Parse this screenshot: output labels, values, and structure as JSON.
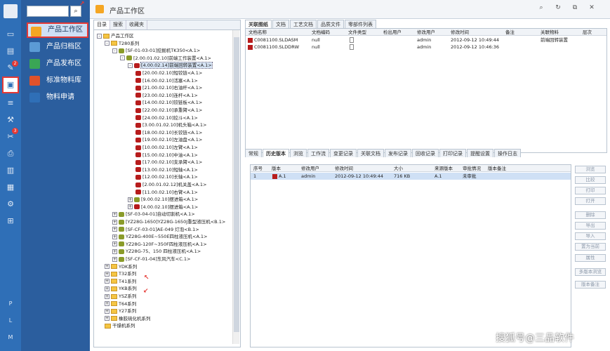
{
  "window": {
    "title": "产品工作区",
    "controls": [
      "⌕",
      "↻",
      "⧉",
      "✕"
    ]
  },
  "rail": {
    "badges": [
      "2",
      "3"
    ],
    "letters": [
      "P",
      "L",
      "M"
    ]
  },
  "nav": {
    "search_placeholder": "",
    "items": [
      {
        "label": "产品工作区",
        "icon": "product-workspace-icon",
        "color": "#f5a623",
        "active": true
      },
      {
        "label": "产品归档区",
        "icon": "archive-icon",
        "color": "#5b9bd5",
        "active": false
      },
      {
        "label": "产品发布区",
        "icon": "publish-icon",
        "color": "#3aa655",
        "active": false
      },
      {
        "label": "标准物料库",
        "icon": "material-library-icon",
        "color": "#e0522b",
        "active": false
      },
      {
        "label": "物料申请",
        "icon": "material-request-icon",
        "color": "#2f6fb7",
        "active": false
      }
    ]
  },
  "tree": {
    "tabs": [
      "目录",
      "搜索",
      "收藏夹"
    ],
    "nodes": [
      {
        "text": "产品工作区",
        "level": 0,
        "kind": "folder",
        "exp": "-"
      },
      {
        "text": "T280系列",
        "level": 1,
        "kind": "folder",
        "exp": "-"
      },
      {
        "text": "[SF-01-03-01]挖掘机TK350<A.1>",
        "level": 2,
        "kind": "asm",
        "exp": "-"
      },
      {
        "text": "[2.00.01.02.10]前端工作装置<A.1>",
        "level": 3,
        "kind": "asm",
        "exp": "-"
      },
      {
        "text": "[4.00.02.14]前端回转装置<A.1>",
        "level": 4,
        "kind": "part",
        "exp": "-",
        "selected": true
      },
      {
        "text": "[20.00.02.10]短铰链<A.1>",
        "level": 5,
        "kind": "part"
      },
      {
        "text": "[16.00.02.10]活塞<A.1>",
        "level": 5,
        "kind": "part"
      },
      {
        "text": "[21.00.02.10]右油杆<A.1>",
        "level": 5,
        "kind": "part"
      },
      {
        "text": "[23.00.02.10]连杆<A.1>",
        "level": 5,
        "kind": "part"
      },
      {
        "text": "[14.00.02.10]铰链板<A.1>",
        "level": 5,
        "kind": "part"
      },
      {
        "text": "[22.00.02.10]承重臂<A.1>",
        "level": 5,
        "kind": "part"
      },
      {
        "text": "[24.00.02.10]挖斗<A.1>",
        "level": 5,
        "kind": "part"
      },
      {
        "text": "[3.00.01.02.10]机头箱<A.1>",
        "level": 5,
        "kind": "part"
      },
      {
        "text": "[18.00.02.10]长铰链<A.1>",
        "level": 5,
        "kind": "part"
      },
      {
        "text": "[19.00.02.10]左油盘<A.1>",
        "level": 5,
        "kind": "part"
      },
      {
        "text": "[10.00.02.10]左臂<A.1>",
        "level": 5,
        "kind": "part"
      },
      {
        "text": "[15.00.02.10]中油<A.1>",
        "level": 5,
        "kind": "part"
      },
      {
        "text": "[17.00.02.10]支承臂<A.1>",
        "level": 5,
        "kind": "part"
      },
      {
        "text": "[13.00.02.10]短轴<A.1>",
        "level": 5,
        "kind": "part"
      },
      {
        "text": "[12.00.02.10]长轴<A.1>",
        "level": 5,
        "kind": "part"
      },
      {
        "text": "[2.00.01.02.12]机关盖<A.1>",
        "level": 5,
        "kind": "part"
      },
      {
        "text": "[11.00.02.10]右臂<A.1>",
        "level": 5,
        "kind": "part"
      },
      {
        "text": "[9.00.02.10]摆进箱<A.1>",
        "level": 4,
        "kind": "asm",
        "exp": "+"
      },
      {
        "text": "[4.00.02.10]摆进箱<A.1>",
        "level": 4,
        "kind": "part",
        "exp": "+"
      },
      {
        "text": "[SF-03-04-01]自动切割机<A.1>",
        "level": 2,
        "kind": "asm",
        "exp": "+"
      },
      {
        "text": "[YZ28G-1650]YZ28G-1650J重型液压机<B.1>",
        "level": 2,
        "kind": "asm",
        "exp": "+"
      },
      {
        "text": "[SF-CF-03-01]AE-049 灯泡<B.1>",
        "level": 2,
        "kind": "asm",
        "exp": "+"
      },
      {
        "text": "YZ28G-400E~550E四柱液压机<A.1>",
        "level": 2,
        "kind": "asm",
        "exp": "+"
      },
      {
        "text": "YZ28G-120F~350F四柱液压机<A.1>",
        "level": 2,
        "kind": "asm",
        "exp": "+"
      },
      {
        "text": "YZ28G-75、150 四柱液压机<A.1>",
        "level": 2,
        "kind": "asm",
        "exp": "+"
      },
      {
        "text": "[SF-CF-01-04]东风汽车<C.1>",
        "level": 2,
        "kind": "asm",
        "exp": "+"
      },
      {
        "text": "YDK系列",
        "level": 1,
        "kind": "folder",
        "exp": "+"
      },
      {
        "text": "T32系列",
        "level": 1,
        "kind": "folder",
        "exp": "+"
      },
      {
        "text": "T41系列",
        "level": 1,
        "kind": "folder",
        "exp": "+"
      },
      {
        "text": "YKB系列",
        "level": 1,
        "kind": "folder",
        "exp": "+"
      },
      {
        "text": "YSZ系列",
        "level": 1,
        "kind": "folder",
        "exp": "+"
      },
      {
        "text": "T64系列",
        "level": 1,
        "kind": "folder",
        "exp": "+"
      },
      {
        "text": "Y27系列",
        "level": 1,
        "kind": "folder",
        "exp": "+"
      },
      {
        "text": "橡胶硫化机系列",
        "level": 1,
        "kind": "folder",
        "exp": "+"
      },
      {
        "text": "干燥机系列",
        "level": 1,
        "kind": "folder",
        "exp": ""
      }
    ]
  },
  "docs": {
    "tabs": [
      "关联图纸",
      "文档",
      "工艺文档",
      "品质文件",
      "零部件列表"
    ],
    "columns": [
      "文档名称",
      "文档编码",
      "文件类型",
      "检出用户",
      "修改用户",
      "修改时间",
      "备注",
      "关联物料",
      "层次"
    ],
    "rows": [
      [
        "C0081100.SLDASM",
        "null",
        "",
        "",
        "admin",
        "2012-09-12 10:49:44",
        "",
        "前端回转装置",
        ""
      ],
      [
        "C0081100.SLDDRW",
        "null",
        "",
        "",
        "admin",
        "2012-09-12 10:46:36",
        "",
        "",
        ""
      ]
    ]
  },
  "history": {
    "tabs": [
      "常规",
      "历史版本",
      "浏览",
      "工作流",
      "变更记录",
      "关联文档",
      "发布记录",
      "回收记录",
      "打印记录",
      "提醒设置",
      "操作日志"
    ],
    "columns": [
      "序号",
      "版本",
      "修改用户",
      "修改时间",
      "大小",
      "来源版本",
      "审批情况",
      "版本备注"
    ],
    "rows": [
      [
        "1",
        "A.1",
        "admin",
        "2012-09-12 10:49:44",
        "716 KB",
        "A.1",
        "未审批",
        ""
      ]
    ]
  },
  "side_buttons": [
    "浏览",
    "比较",
    "打印",
    "打开",
    "删除",
    "导出",
    "导入",
    "置为当前",
    "属性",
    "多版本浏览",
    "版本备注"
  ],
  "watermark": "搜狐号@三品软件"
}
